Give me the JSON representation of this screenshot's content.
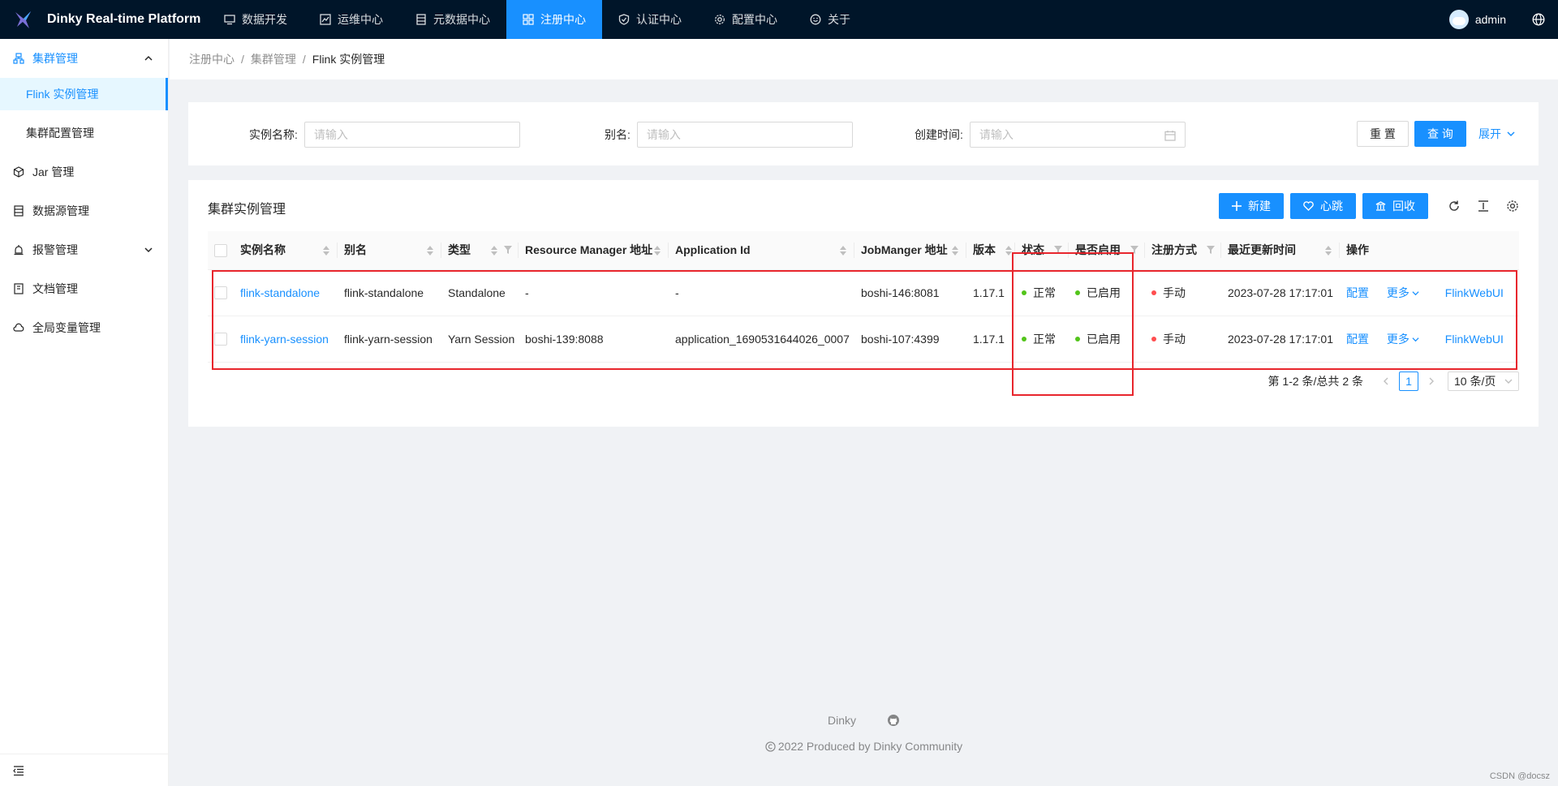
{
  "header": {
    "app_title": "Dinky Real-time Platform",
    "nav": [
      {
        "label": "数据开发",
        "icon": "monitor-icon",
        "active": false
      },
      {
        "label": "运维中心",
        "icon": "fund-icon",
        "active": false
      },
      {
        "label": "元数据中心",
        "icon": "database-icon",
        "active": false
      },
      {
        "label": "注册中心",
        "icon": "appstore-icon",
        "active": true
      },
      {
        "label": "认证中心",
        "icon": "safety-icon",
        "active": false
      },
      {
        "label": "配置中心",
        "icon": "setting-icon",
        "active": false
      },
      {
        "label": "关于",
        "icon": "smile-icon",
        "active": false
      }
    ],
    "user_name": "admin"
  },
  "sidebar": {
    "items": [
      {
        "label": "集群管理",
        "icon": "cluster-icon"
      },
      {
        "label": "Jar 管理",
        "icon": "code-sandbox-icon"
      },
      {
        "label": "数据源管理",
        "icon": "table-icon"
      },
      {
        "label": "报警管理",
        "icon": "alert-icon"
      },
      {
        "label": "文档管理",
        "icon": "book-icon"
      },
      {
        "label": "全局变量管理",
        "icon": "cloud-icon"
      }
    ],
    "sub_items": [
      {
        "label": "Flink 实例管理",
        "active": true
      },
      {
        "label": "集群配置管理",
        "active": false
      }
    ]
  },
  "breadcrumb": [
    "注册中心",
    "集群管理",
    "Flink 实例管理"
  ],
  "search": {
    "name_label": "实例名称:",
    "alias_label": "别名:",
    "created_label": "创建时间:",
    "placeholder": "请输入",
    "reset_label": "重 置",
    "query_label": "查 询",
    "expand_label": "展开"
  },
  "table_card": {
    "title": "集群实例管理",
    "new_label": "新建",
    "heartbeat_label": "心跳",
    "recycle_label": "回收",
    "columns": [
      "实例名称",
      "别名",
      "类型",
      "Resource Manager 地址",
      "Application Id",
      "JobManger 地址",
      "版本",
      "状态",
      "是否启用",
      "注册方式",
      "最近更新时间",
      "操作"
    ],
    "rows": [
      {
        "name": "flink-standalone",
        "alias": "flink-standalone",
        "type": "Standalone",
        "rm_address": "-",
        "app_id": "-",
        "jm_address": "boshi-146:8081",
        "version": "1.17.1",
        "status": "正常",
        "enabled": "已启用",
        "register": "手动",
        "updated": "2023-07-28 17:17:01",
        "op_config": "配置",
        "op_more": "更多",
        "op_web": "FlinkWebUI"
      },
      {
        "name": "flink-yarn-session",
        "alias": "flink-yarn-session",
        "type": "Yarn Session",
        "rm_address": "boshi-139:8088",
        "app_id": "application_1690531644026_0007",
        "jm_address": "boshi-107:4399",
        "version": "1.17.1",
        "status": "正常",
        "enabled": "已启用",
        "register": "手动",
        "updated": "2023-07-28 17:17:01",
        "op_config": "配置",
        "op_more": "更多",
        "op_web": "FlinkWebUI"
      }
    ],
    "pagination": {
      "total_text": "第 1-2 条/总共 2 条",
      "current_page": "1",
      "page_size": "10 条/页"
    }
  },
  "footer": {
    "brand": "Dinky",
    "copyright": "2022 Produced by Dinky Community"
  },
  "watermark": "CSDN @docsz",
  "colors": {
    "header_bg": "#001529",
    "primary": "#1890ff",
    "status_ok": "#52c41a",
    "status_manual": "#ff4d4f",
    "annotation": "#e8262d"
  }
}
